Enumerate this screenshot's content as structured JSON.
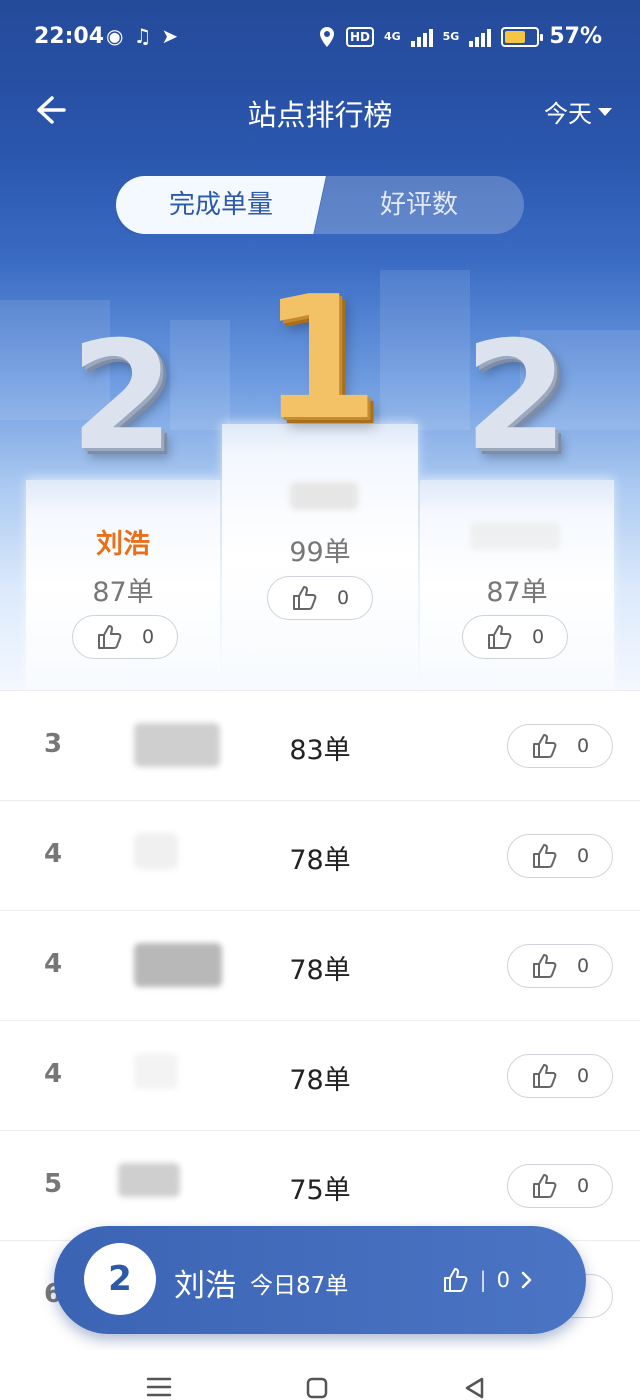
{
  "status_bar": {
    "time": "22:04",
    "network_4g": "4G",
    "network_5g": "5G",
    "hd": "HD",
    "battery": "57%"
  },
  "nav": {
    "title": "站点排行榜",
    "period": "今天"
  },
  "tabs": {
    "active": "完成单量",
    "inactive": "好评数"
  },
  "podium": {
    "left": {
      "digit": "2",
      "name": "刘浩",
      "count": "87单",
      "likes": "0"
    },
    "center": {
      "digit": "1",
      "name": "",
      "count": "99单",
      "likes": "0"
    },
    "right": {
      "digit": "2",
      "name": "",
      "count": "87单",
      "likes": "0"
    }
  },
  "list": [
    {
      "rank": "3",
      "count": "83单",
      "likes": "0"
    },
    {
      "rank": "4",
      "count": "78单",
      "likes": "0"
    },
    {
      "rank": "4",
      "count": "78单",
      "likes": "0"
    },
    {
      "rank": "4",
      "count": "78单",
      "likes": "0"
    },
    {
      "rank": "5",
      "count": "75单",
      "likes": "0"
    },
    {
      "rank": "6",
      "count": "",
      "likes": ""
    }
  ],
  "bottom_bar": {
    "rank": "2",
    "name": "刘浩",
    "today": "今日87单",
    "likes": "0",
    "sep": "|"
  },
  "colors": {
    "primary": "#2d5aa8",
    "accent_name": "#e8701a",
    "gold": "#f3c166"
  }
}
